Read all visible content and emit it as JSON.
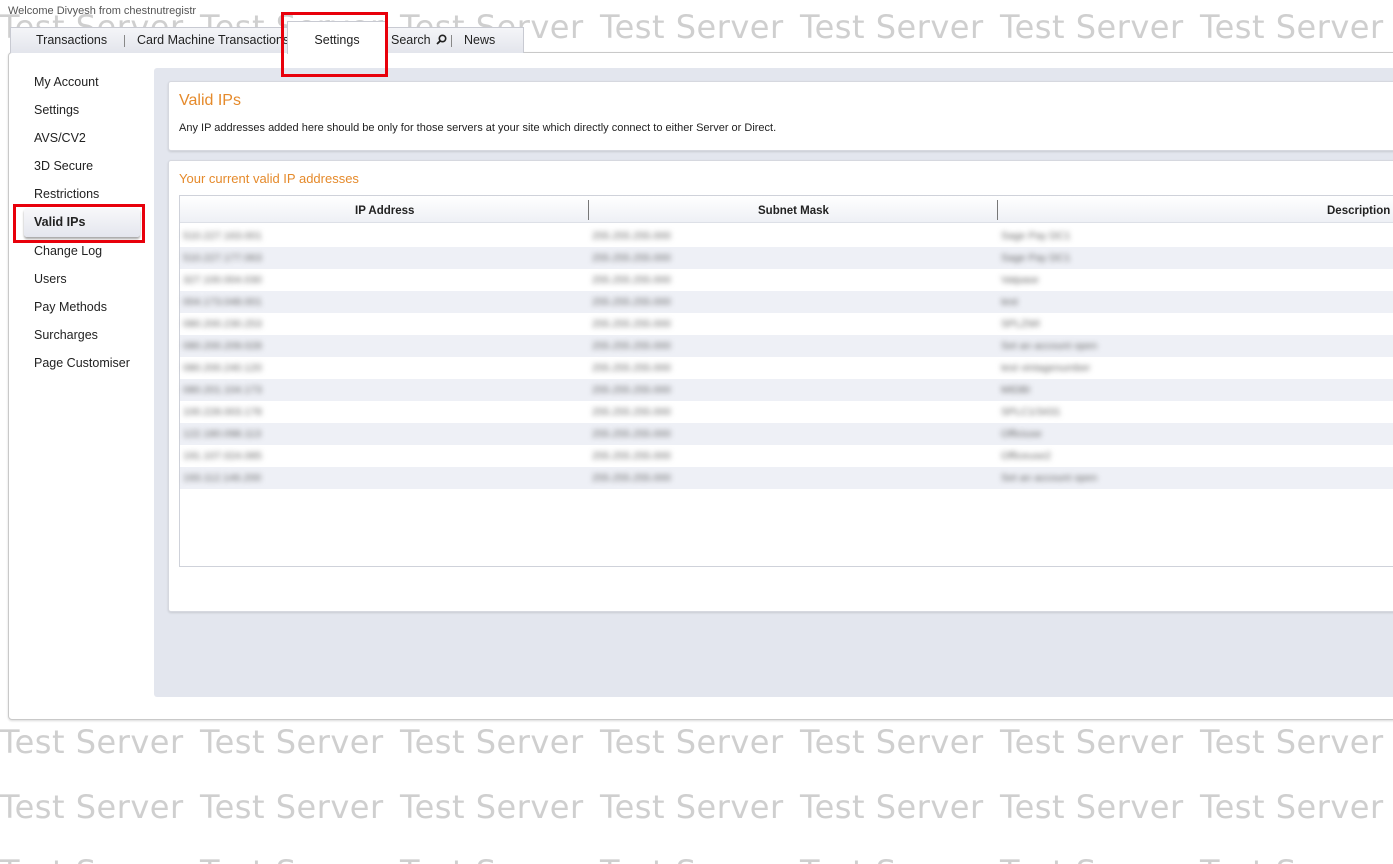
{
  "watermark_text": "Test Server",
  "welcome": "Welcome Divyesh from chestnutregistr",
  "tabs": {
    "transactions": "Transactions",
    "card_machine": "Card Machine Transactions",
    "settings": "Settings",
    "search": "Search",
    "news": "News"
  },
  "sidebar": {
    "items": [
      "My Account",
      "Settings",
      "AVS/CV2",
      "3D Secure",
      "Restrictions",
      "Valid IPs",
      "Change Log",
      "Users",
      "Pay Methods",
      "Surcharges",
      "Page Customiser"
    ],
    "active_index": 5
  },
  "valid_ips": {
    "title": "Valid IPs",
    "description": "Any IP addresses added here should be only for those servers at your site which directly connect to either Server or Direct.",
    "subtitle": "Your current valid IP addresses",
    "columns": [
      "IP Address",
      "Subnet Mask",
      "Description"
    ],
    "rows": [
      [
        "510.227.163.001",
        "255.255.255.000",
        "Sage Pay DC1"
      ],
      [
        "510.227.177.063",
        "255.255.255.000",
        "Sage Pay DC1"
      ],
      [
        "327.100.004.030",
        "255.255.255.000",
        "Vatpase"
      ],
      [
        "004.173.048.001",
        "255.255.255.000",
        "test"
      ],
      [
        "080.200.230.253",
        "255.255.255.000",
        "SPLZWI"
      ],
      [
        "080.200.209.028",
        "255.255.255.000",
        "Set an account open"
      ],
      [
        "080.200.240.120",
        "255.255.255.000",
        "test vintagenumber"
      ],
      [
        "080.201.104.173",
        "255.255.255.000",
        "MIDBI"
      ],
      [
        "100.228.003.178",
        "255.255.255.000",
        "SPLC1/3431"
      ],
      [
        "122.180.098.113",
        "255.255.255.000",
        "Officiuse"
      ],
      [
        "191.107.024.085",
        "255.255.255.000",
        "Officeuse2"
      ],
      [
        "193.112.146.200",
        "255.255.255.000",
        "Set an account open"
      ]
    ]
  },
  "colors": {
    "accent": "#e58a2b",
    "highlight": "#e8000b",
    "watermark": "#cfcfcf"
  }
}
